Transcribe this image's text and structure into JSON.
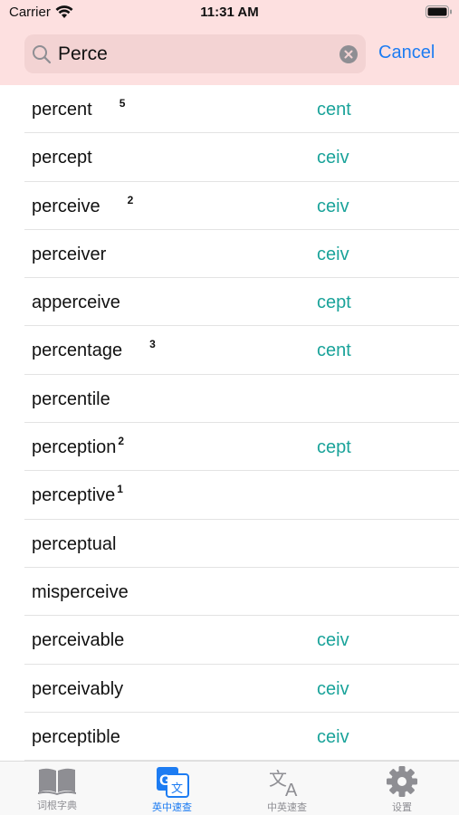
{
  "status_bar": {
    "carrier": "Carrier",
    "time": "11:31 AM"
  },
  "search": {
    "value": "Perce",
    "cancel_label": "Cancel"
  },
  "results": [
    {
      "word": "percent",
      "sup": "5",
      "sup_gap": true,
      "root": "cent"
    },
    {
      "word": "percept",
      "sup": "",
      "sup_gap": false,
      "root": "ceiv"
    },
    {
      "word": "perceive",
      "sup": "2",
      "sup_gap": true,
      "root": "ceiv"
    },
    {
      "word": "perceiver",
      "sup": "",
      "sup_gap": false,
      "root": "ceiv"
    },
    {
      "word": "apperceive",
      "sup": "",
      "sup_gap": false,
      "root": "cept"
    },
    {
      "word": "percentage",
      "sup": "3",
      "sup_gap": true,
      "root": "cent"
    },
    {
      "word": "percentile",
      "sup": "",
      "sup_gap": false,
      "root": ""
    },
    {
      "word": "perception",
      "sup": "2",
      "sup_gap": false,
      "root": "cept"
    },
    {
      "word": "perceptive",
      "sup": "1",
      "sup_gap": false,
      "root": ""
    },
    {
      "word": "perceptual",
      "sup": "",
      "sup_gap": false,
      "root": ""
    },
    {
      "word": "misperceive",
      "sup": "",
      "sup_gap": false,
      "root": ""
    },
    {
      "word": "perceivable",
      "sup": "",
      "sup_gap": false,
      "root": "ceiv"
    },
    {
      "word": "perceivably",
      "sup": "",
      "sup_gap": false,
      "root": "ceiv"
    },
    {
      "word": "perceptible",
      "sup": "",
      "sup_gap": false,
      "root": "ceiv"
    }
  ],
  "tabs": [
    {
      "label": "词根字典",
      "icon": "book-icon",
      "active": false
    },
    {
      "label": "英中速查",
      "icon": "google-translate-icon",
      "active": true
    },
    {
      "label": "中英速查",
      "icon": "translate-icon",
      "active": false
    },
    {
      "label": "设置",
      "icon": "gear-icon",
      "active": false
    }
  ],
  "colors": {
    "header_bg": "#fde0e0",
    "search_bg": "#f3d3d3",
    "accent": "#1d7cf2",
    "root_color": "#1aa39a"
  }
}
